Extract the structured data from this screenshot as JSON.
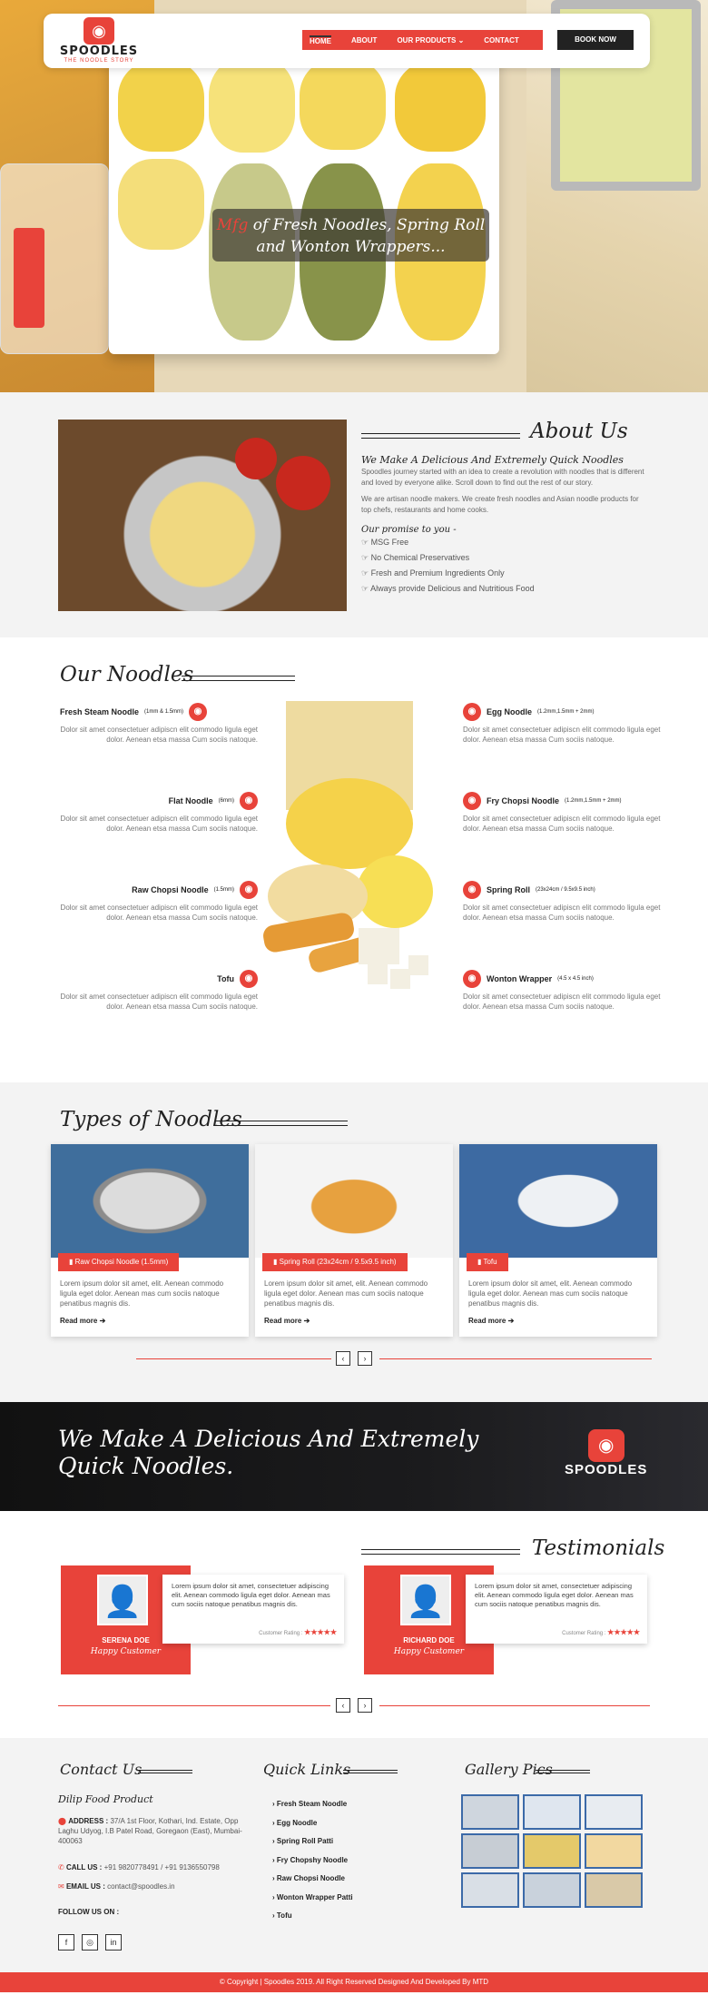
{
  "brand": {
    "name": "SPOODLES",
    "tagline": "THE NOODLE STORY"
  },
  "nav": {
    "items": [
      "HOME",
      "ABOUT",
      "OUR PRODUCTS",
      "CONTACT"
    ],
    "book": "BOOK NOW"
  },
  "hero": {
    "caption_highlight": "Mfg",
    "caption_rest": " of Fresh Noodles, Spring Roll and Wonton Wrappers..."
  },
  "about": {
    "title": "About Us",
    "subtitle": "We Make A Delicious And Extremely Quick Noodles",
    "p1": "Spoodles journey started with an idea to create a revolution with noodles that is different and loved by everyone alike. Scroll down to find out the rest of our story.",
    "p2": "We are artisan noodle makers. We create fresh noodles and Asian noodle products for top chefs, restaurants and home cooks.",
    "promise": "Our promise to you -",
    "points": [
      "MSG Free",
      "No Chemical Preservatives",
      "Fresh and Premium Ingredients Only",
      "Always provide Delicious and Nutritious Food"
    ]
  },
  "our_noodles": {
    "title": "Our Noodles",
    "desc": "Dolor sit amet consectetuer adipiscn elit commodo ligula eget dolor. Aenean etsa massa Cum sociis natoque.",
    "left": [
      {
        "name": "Fresh Steam Noodle",
        "size": "(1mm & 1.5mm)"
      },
      {
        "name": "Flat Noodle",
        "size": "(6mm)"
      },
      {
        "name": "Raw Chopsi Noodle",
        "size": "(1.5mm)"
      },
      {
        "name": "Tofu",
        "size": ""
      }
    ],
    "right": [
      {
        "name": "Egg Noodle",
        "size": "(1.2mm,1.5mm + 2mm)"
      },
      {
        "name": "Fry Chopsi Noodle",
        "size": "(1.2mm,1.5mm + 2mm)"
      },
      {
        "name": "Spring Roll",
        "size": "(23x24cm / 9.5x9.5 inch)"
      },
      {
        "name": "Wonton Wrapper",
        "size": "(4.5 x 4.5 inch)"
      }
    ]
  },
  "types": {
    "title": "Types of Noodles",
    "text": "Lorem ipsum dolor sit amet, elit. Aenean commodo ligula eget dolor. Aenean mas cum sociis natoque penatibus magnis dis.",
    "read_more": "Read more",
    "cards": [
      "Raw Chopsi Noodle (1.5mm)",
      "Spring Roll (23x24cm / 9.5x9.5 inch)",
      "Tofu"
    ],
    "prev": "‹",
    "next": "›"
  },
  "banner": {
    "text": "We Make A Delicious And Extremely Quick Noodles."
  },
  "testimonials": {
    "title": "Testimonials",
    "quote": "Lorem ipsum dolor sit amet, consectetuer adipiscing elit. Aenean commodo ligula eget dolor. Aenean mas cum sociis natoque penatibus magnis dis.",
    "rating_label": "Customer Rating :",
    "stars": "★★★★★",
    "items": [
      {
        "name": "SERENA DOE",
        "role": "Happy Customer"
      },
      {
        "name": "RICHARD DOE",
        "role": "Happy Customer"
      }
    ]
  },
  "footer": {
    "contact_title": "Contact Us",
    "company": "Dilip Food Product",
    "address_label": "ADDRESS :",
    "address": "37/A 1st Floor, Kothari, Ind. Estate, Opp Laghu Udyog, I.B Patel Road, Goregaon (East), Mumbai-400063",
    "call_label": "CALL US :",
    "phone": "+91 9820778491 / +91 9136550798",
    "email_label": "EMAIL US :",
    "email": "contact@spoodles.in",
    "follow": "FOLLOW US ON :",
    "quick_title": "Quick Links",
    "links": [
      "Fresh Steam Noodle",
      "Egg Noodle",
      "Spring Roll Patti",
      "Fry Chopshy Noodle",
      "Raw Chopsi Noodle",
      "Wonton Wrapper Patti",
      "Tofu"
    ],
    "gallery_title": "Gallery Pics",
    "copyright": "© Copyright | Spoodles 2019. All Right Reserved Designed And Developed By MTD"
  },
  "colors": {
    "accent": "#e8433a",
    "dark": "#222222",
    "light_bg": "#f3f3f3"
  }
}
